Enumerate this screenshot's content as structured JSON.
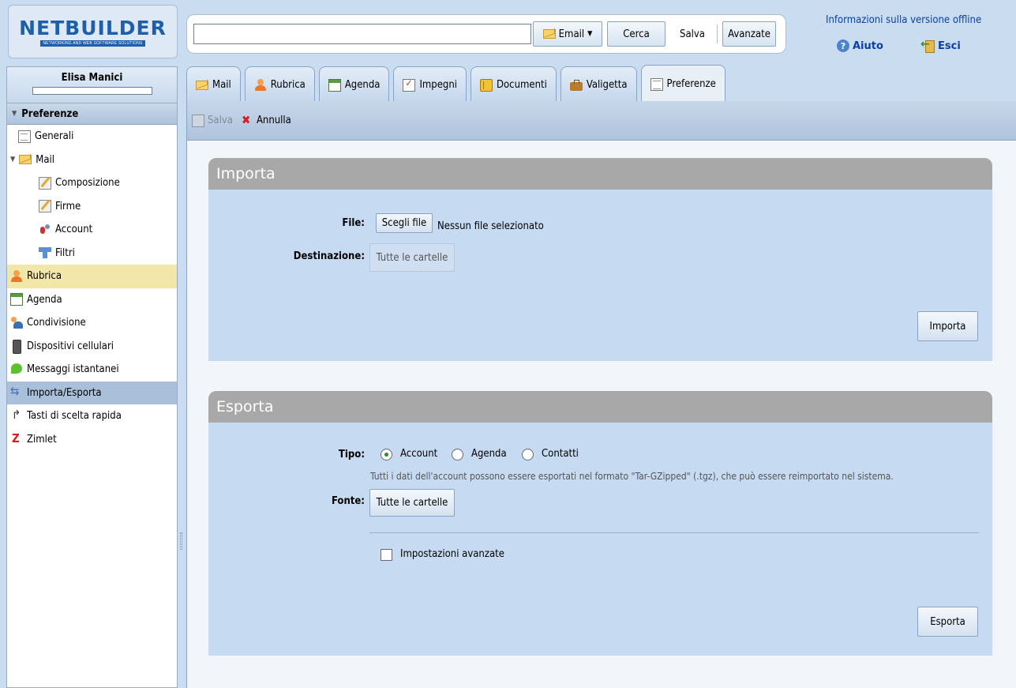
{
  "app": {
    "logo_text": "NETBUILDER",
    "logo_tagline": "NETWORKING AND WEB SOFTWARE SOLUTIONS"
  },
  "search": {
    "value": "",
    "placeholder": "",
    "type_label": "Email",
    "search_label": "Cerca",
    "save_label": "Salva",
    "advanced_label": "Avanzate"
  },
  "header_links": {
    "offline_info": "Informazioni sulla versione offline",
    "help": "Aiuto",
    "exit": "Esci"
  },
  "user": {
    "name": "Elisa Manici"
  },
  "sidebar": {
    "header": "Preferenze",
    "items": [
      {
        "label": "Generali",
        "icon": "document-icon"
      },
      {
        "label": "Mail",
        "icon": "envelope-icon"
      },
      {
        "label": "Composizione",
        "icon": "compose-icon"
      },
      {
        "label": "Firme",
        "icon": "signature-icon"
      },
      {
        "label": "Account",
        "icon": "account-icon"
      },
      {
        "label": "Filtri",
        "icon": "filter-icon"
      },
      {
        "label": "Rubrica",
        "icon": "contacts-icon"
      },
      {
        "label": "Agenda",
        "icon": "calendar-icon"
      },
      {
        "label": "Condivisione",
        "icon": "sharing-icon"
      },
      {
        "label": "Dispositivi cellulari",
        "icon": "phone-icon"
      },
      {
        "label": "Messaggi istantanei",
        "icon": "chat-icon"
      },
      {
        "label": "Importa/Esporta",
        "icon": "import-export-icon"
      },
      {
        "label": "Tasti di scelta rapida",
        "icon": "shortcut-icon"
      },
      {
        "label": "Zimlet",
        "icon": "zimlet-icon"
      }
    ]
  },
  "tabs": [
    {
      "label": "Mail",
      "icon": "envelope-icon"
    },
    {
      "label": "Rubrica",
      "icon": "contacts-icon"
    },
    {
      "label": "Agenda",
      "icon": "calendar-icon"
    },
    {
      "label": "Impegni",
      "icon": "tasks-icon"
    },
    {
      "label": "Documenti",
      "icon": "notebook-icon"
    },
    {
      "label": "Valigetta",
      "icon": "briefcase-icon"
    },
    {
      "label": "Preferenze",
      "icon": "preferences-icon"
    }
  ],
  "actionbar": {
    "save": "Salva",
    "cancel": "Annulla"
  },
  "import": {
    "title": "Importa",
    "file_label": "File:",
    "choose_file": "Scegli file",
    "no_file": "Nessun file selezionato",
    "destination_label": "Destinazione:",
    "destination_value": "Tutte le cartelle",
    "button": "Importa"
  },
  "export": {
    "title": "Esporta",
    "type_label": "Tipo:",
    "type_options": [
      "Account",
      "Agenda",
      "Contatti"
    ],
    "type_selected": "Account",
    "description": "Tutti i dati dell'account possono essere esportati nel formato \"Tar-GZipped\" (.tgz), che può essere reimportato nel sistema.",
    "source_label": "Fonte:",
    "source_value": "Tutte le cartelle",
    "advanced_label": "Impostazioni avanzate",
    "advanced_checked": false,
    "button": "Esporta"
  },
  "colors": {
    "accent": "#1d5fa8",
    "selected_nav": "#aabfd9",
    "highlight_nav": "#f3e6a9",
    "section_header": "#a8a8a8",
    "section_body": "#c6dbf2"
  }
}
